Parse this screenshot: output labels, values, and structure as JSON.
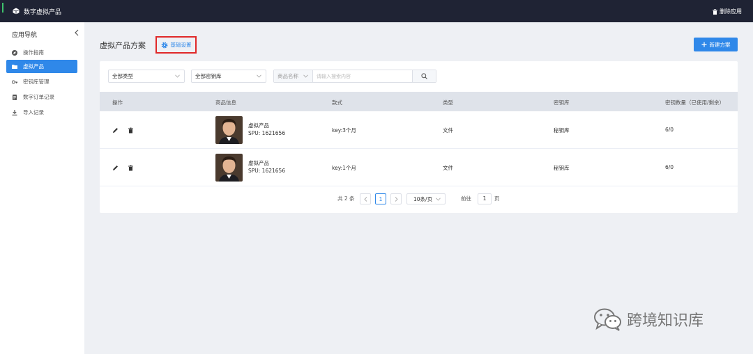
{
  "header": {
    "app_title": "数字虚拟产品",
    "delete_app": "删除应用"
  },
  "sidebar": {
    "title": "应用导航",
    "items": [
      {
        "label": "操作指南",
        "icon": "guide-icon"
      },
      {
        "label": "虚拟产品",
        "icon": "folder-icon",
        "active": true
      },
      {
        "label": "密钥库管理",
        "icon": "key-icon"
      },
      {
        "label": "数字订单记录",
        "icon": "order-icon"
      },
      {
        "label": "导入记录",
        "icon": "download-icon"
      }
    ]
  },
  "main": {
    "page_title": "虚拟产品方案",
    "settings_link": "基础设置",
    "new_plan_button": "新建方案"
  },
  "filters": {
    "type_select": "全部类型",
    "keystore_select": "全部密钥库",
    "search_field_select": "商品名称",
    "search_placeholder": "请输入搜索内容"
  },
  "table": {
    "columns": [
      "操作",
      "商品信息",
      "款式",
      "类型",
      "密钥库",
      "密钥数量（已使用/剩余）"
    ],
    "rows": [
      {
        "name": "虚拟产品",
        "spu": "SPU: 1621656",
        "style": "key:3个月",
        "type": "文件",
        "keystore": "秘钥库",
        "count": "6/0"
      },
      {
        "name": "虚拟产品",
        "spu": "SPU: 1621656",
        "style": "key:1个月",
        "type": "文件",
        "keystore": "秘钥库",
        "count": "6/0"
      }
    ]
  },
  "pagination": {
    "total": "共 2 条",
    "current_page": "1",
    "page_size": "10条/页",
    "goto_label": "前往",
    "goto_value": "1",
    "page_suffix": "页"
  },
  "watermark": {
    "text": "跨境知识库"
  },
  "colors": {
    "primary": "#2f88e9",
    "header_bg": "#1f2334",
    "highlight_border": "#e02828"
  }
}
